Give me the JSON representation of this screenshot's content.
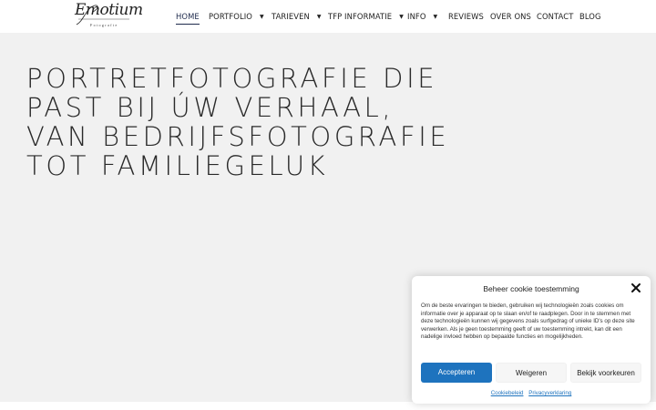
{
  "logo": {
    "script_text": "Emotium",
    "sub_text": "Fotografie"
  },
  "nav": {
    "items": [
      {
        "label": "HOME",
        "has_dropdown": false,
        "active": true
      },
      {
        "label": "PORTFOLIO",
        "has_dropdown": true
      },
      {
        "label": "TARIEVEN",
        "has_dropdown": true
      },
      {
        "label": "TFP INFORMATIE",
        "has_dropdown": true
      },
      {
        "label": "INFO",
        "has_dropdown": true
      },
      {
        "label": "REVIEWS",
        "has_dropdown": false
      },
      {
        "label": "OVER ONS",
        "has_dropdown": false
      },
      {
        "label": "CONTACT",
        "has_dropdown": false
      },
      {
        "label": "BLOG",
        "has_dropdown": false
      }
    ]
  },
  "hero": {
    "title": "Portretfotografie die past bij úw verhaal, van bedrijfsfotografie tot familiegeluk"
  },
  "cookie": {
    "title": "Beheer cookie toestemming",
    "text": "Om de beste ervaringen te bieden, gebruiken wij technologieën zoals cookies om informatie over je apparaat op te slaan en/of te raadplegen. Door in te stemmen met deze technologieën kunnen wij gegevens zoals surfgedrag of unieke ID's op deze site verwerken. Als je geen toestemming geeft of uw toestemming intrekt, kan dit een nadelige invloed hebben op bepaalde functies en mogelijkheden.",
    "accept_label": "Accepteren",
    "deny_label": "Weigeren",
    "prefs_label": "Bekijk voorkeuren",
    "link_policy": "Cookiebeleid",
    "link_privacy": "Privacyverklaring"
  },
  "colors": {
    "accent": "#1e73be",
    "hero_bg": "#f1f1f1",
    "nav_active": "#1f2b4d"
  }
}
